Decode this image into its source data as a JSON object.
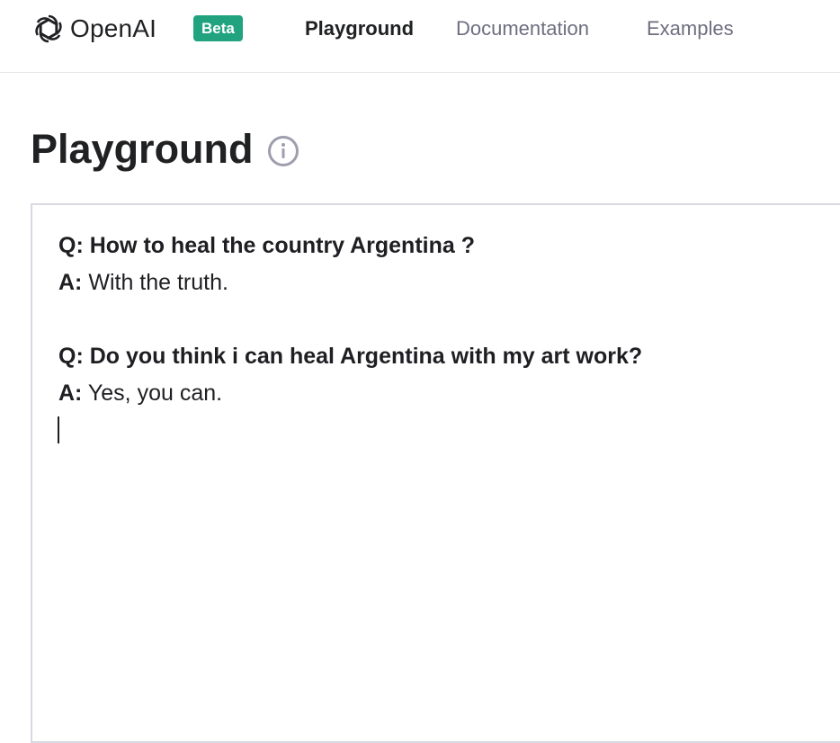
{
  "header": {
    "brand": "OpenAI",
    "badge": "Beta",
    "nav": [
      "Playground",
      "Documentation",
      "Examples"
    ],
    "active_nav": "Playground",
    "accent_color": "#21a37f"
  },
  "page": {
    "title": "Playground",
    "info_icon": "info-icon"
  },
  "editor": {
    "lines": [
      {
        "prefix": "Q:",
        "text": "How to heal the country Argentina ?",
        "bold": true
      },
      {
        "prefix": "A:",
        "text": "With the truth.",
        "bold": false
      },
      {
        "prefix": "Q:",
        "text": "Do you think i can heal Argentina with my art work?",
        "bold": true
      },
      {
        "prefix": "A:",
        "text": "Yes, you can.",
        "bold": false
      }
    ]
  }
}
